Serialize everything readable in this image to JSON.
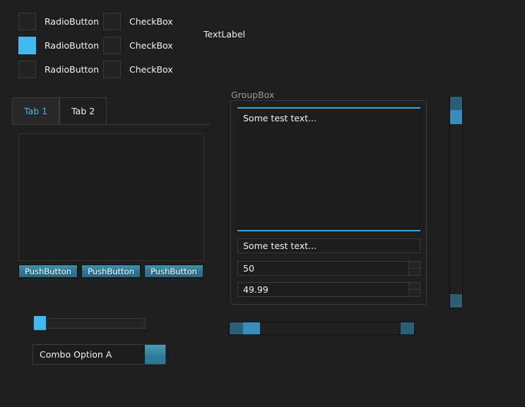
{
  "theme": {
    "background": "#1e1e1e",
    "accent": "#42b9ef",
    "accent_dim": "#2b5f76",
    "accent_handle": "#358dba",
    "button_teal": "#2d7f9e",
    "text": "#f2f2f2",
    "muted_text": "#9a9a9a",
    "border": "#3a3a3a",
    "focus_line": "#2ea8e0"
  },
  "radios": [
    {
      "label": "RadioButton",
      "checked": false
    },
    {
      "label": "RadioButton",
      "checked": true
    },
    {
      "label": "RadioButton",
      "checked": false
    }
  ],
  "checkboxes": [
    {
      "label": "CheckBox",
      "checked": false
    },
    {
      "label": "CheckBox",
      "checked": false
    },
    {
      "label": "CheckBox",
      "checked": false
    }
  ],
  "text_label": {
    "text": "TextLabel"
  },
  "tabs": [
    {
      "label": "Tab 1",
      "active": true
    },
    {
      "label": "Tab 2",
      "active": false
    }
  ],
  "push_buttons": [
    {
      "label": "PushButton"
    },
    {
      "label": "PushButton"
    },
    {
      "label": "PushButton"
    }
  ],
  "slider": {
    "value_percent": 2
  },
  "combo": {
    "selected": "Combo Option A",
    "arrow_icon": "chevron-down-icon"
  },
  "groupbox": {
    "title": "GroupBox",
    "text_edit": {
      "value": "Some test text...",
      "focused": true
    },
    "line_edit": {
      "value": "Some test text..."
    },
    "spin_box": {
      "value": "50",
      "up_icon": "arrow-up-icon",
      "down_icon": "arrow-down-icon"
    },
    "double_spin_box": {
      "value": "49.99",
      "up_icon": "arrow-up-icon",
      "down_icon": "arrow-down-icon"
    }
  },
  "vertical_scrollbar": {
    "up_icon": "arrow-up-icon",
    "down_icon": "arrow-down-icon",
    "handle_position_percent": 0
  },
  "horizontal_scrollbar": {
    "left_icon": "arrow-left-icon",
    "right_icon": "arrow-right-icon",
    "handle_position_percent": 0
  }
}
